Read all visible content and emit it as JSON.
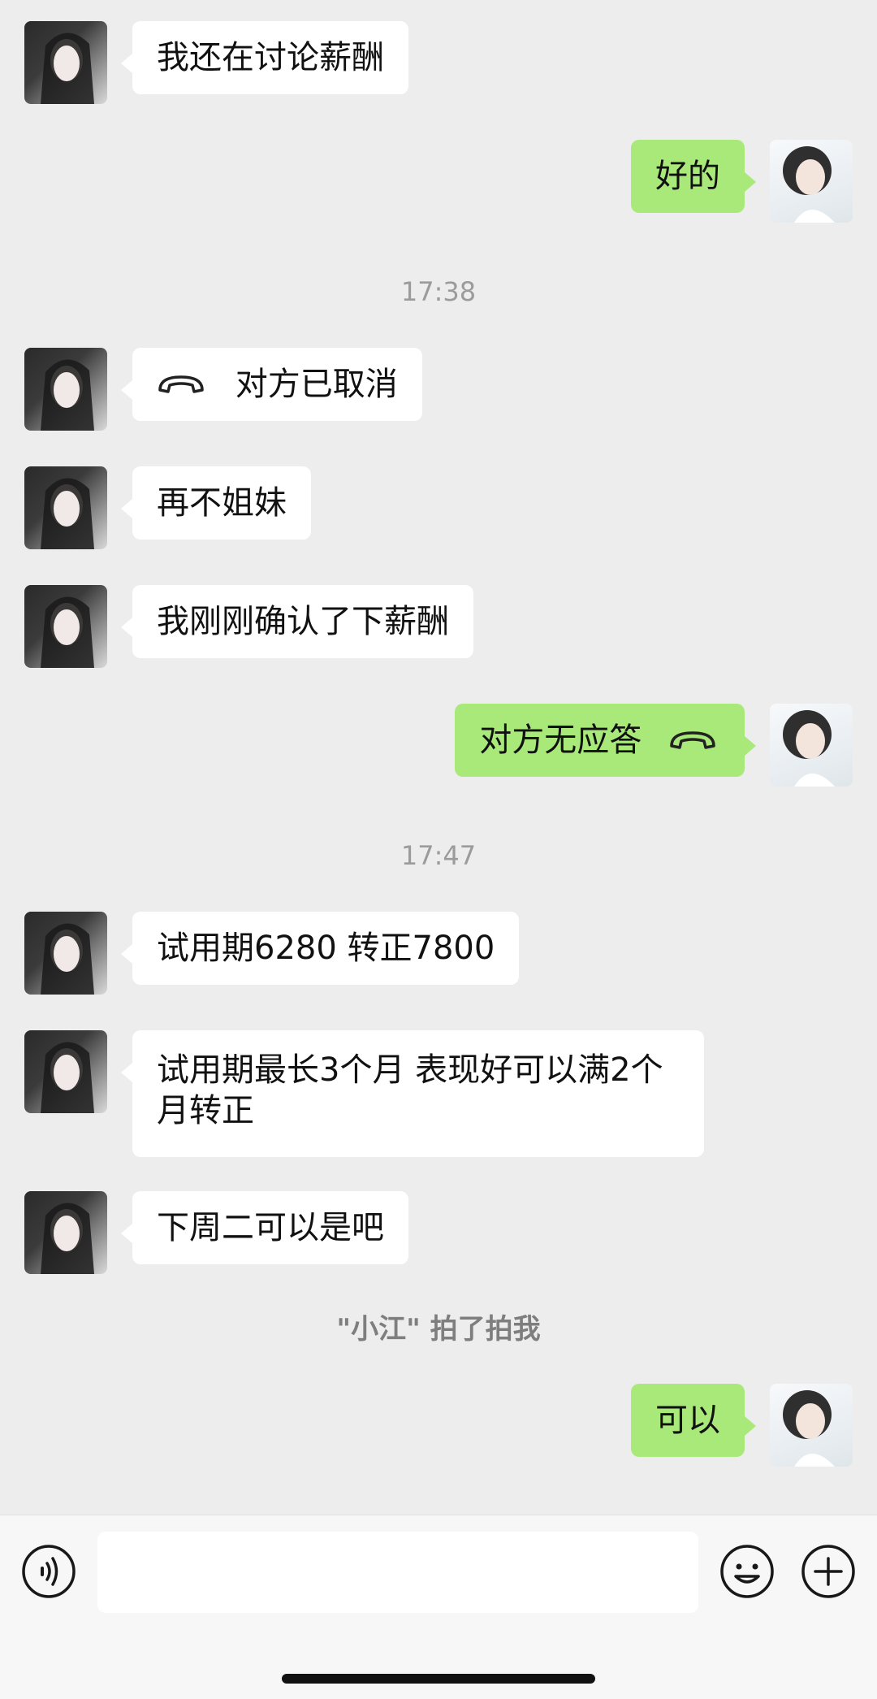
{
  "messages": [
    {
      "side": "in",
      "text": "我还在讨论薪酬"
    },
    {
      "side": "out",
      "text": "好的"
    },
    {
      "time": "17:38"
    },
    {
      "side": "in",
      "call": true,
      "text": "对方已取消"
    },
    {
      "side": "in",
      "text": "再不姐妹"
    },
    {
      "side": "in",
      "text": "我刚刚确认了下薪酬"
    },
    {
      "side": "out",
      "call": true,
      "text": "对方无应答"
    },
    {
      "time": "17:47"
    },
    {
      "side": "in",
      "text": "试用期6280 转正7800"
    },
    {
      "side": "in",
      "text": "试用期最长3个月 表现好可以满2个月转正"
    },
    {
      "side": "in",
      "text": "下周二可以是吧"
    },
    {
      "system": "\"小江\" 拍了拍我"
    },
    {
      "side": "out",
      "text": "可以"
    }
  ],
  "input": {
    "placeholder": "",
    "value": ""
  },
  "icons": {
    "voice": "voice-icon",
    "emoji": "emoji-icon",
    "plus": "plus-icon",
    "call": "phone-icon"
  },
  "colors": {
    "background": "#ededed",
    "bubble_out": "#a9e97a",
    "bubble_in": "#ffffff"
  }
}
